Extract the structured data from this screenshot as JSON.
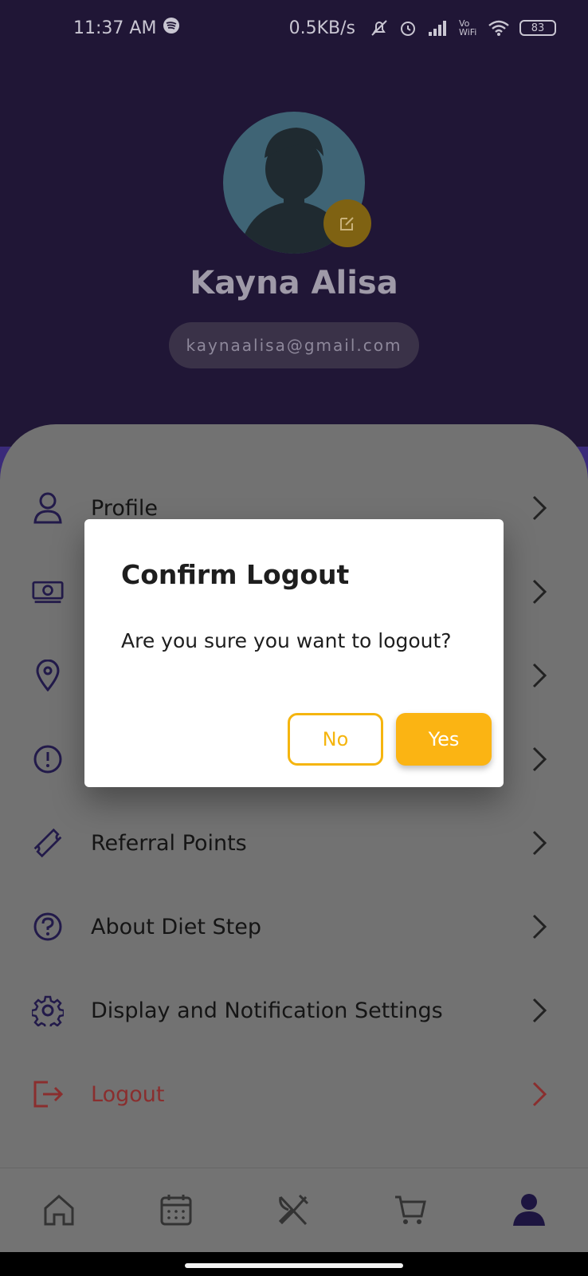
{
  "status_bar": {
    "time": "11:37 AM",
    "net_speed": "0.5KB/s",
    "battery": "83",
    "network_label": "Vo WiFi"
  },
  "profile": {
    "name": "Kayna Alisa",
    "email": "kaynaalisa@gmail.com"
  },
  "menu": {
    "items": [
      {
        "label": "Profile",
        "icon": "user-icon"
      },
      {
        "label": "",
        "icon": "money-icon"
      },
      {
        "label": "",
        "icon": "location-pin-icon"
      },
      {
        "label": "",
        "icon": "info-circle-icon"
      },
      {
        "label": "Referral Points",
        "icon": "ticket-icon"
      },
      {
        "label": "About Diet Step",
        "icon": "question-circle-icon"
      },
      {
        "label": "Display and Notification Settings",
        "icon": "gear-icon"
      },
      {
        "label": "Logout",
        "icon": "logout-icon"
      }
    ]
  },
  "dialog": {
    "title": "Confirm Logout",
    "message": "Are you sure you want to logout?",
    "no_label": "No",
    "yes_label": "Yes"
  },
  "bottom_nav": {
    "items": [
      "home-icon",
      "calendar-icon",
      "meals-icon",
      "cart-icon",
      "profile-icon"
    ],
    "active": "profile-icon"
  },
  "colors": {
    "accent": "#fbb413",
    "header_bg": "#201636",
    "logout": "#8a2e2e"
  }
}
